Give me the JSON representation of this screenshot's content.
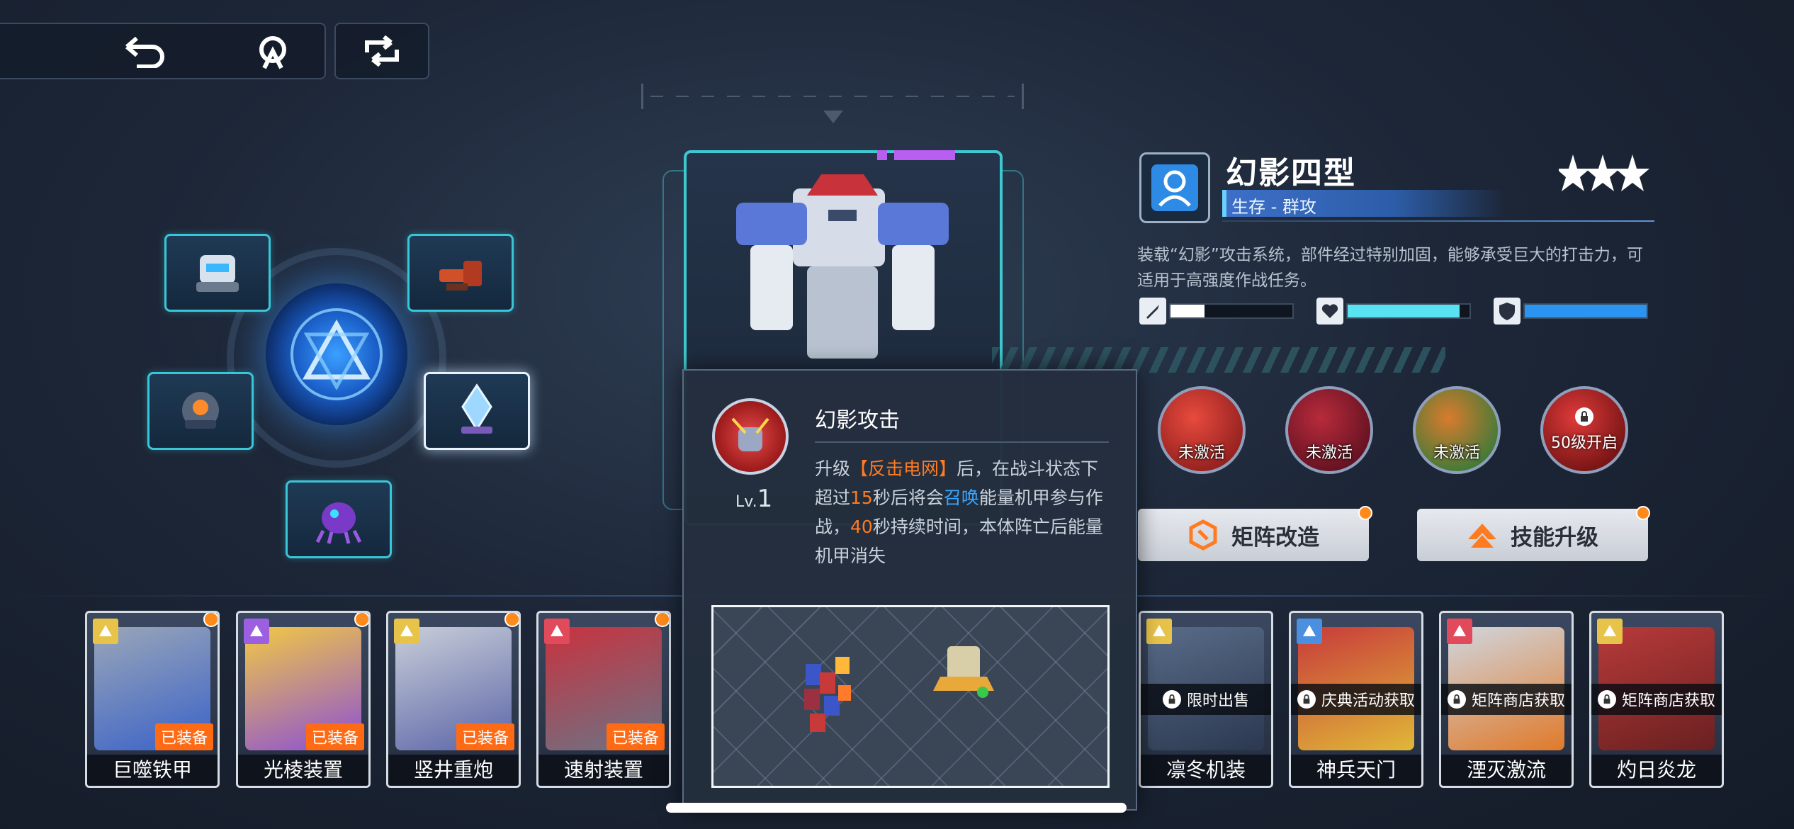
{
  "toolbar": {
    "back_icon": "undo-arrow-icon",
    "signal_icon": "wireless-tower-icon",
    "refresh_icon": "swap-arrows-icon"
  },
  "mech": {
    "name": "幻影四型",
    "tag": "生存 - 群攻",
    "rarity_stars": 3,
    "description": "装载“幻影”攻击系统，部件经过特别加固，能够承受巨大的打击力，可适用于高强度作战任务。",
    "stats": [
      {
        "icon": "sword-icon",
        "value": 0.28,
        "color": "#ffffff"
      },
      {
        "icon": "heart-icon",
        "value": 0.92,
        "color": "#58e2f2"
      },
      {
        "icon": "shield-icon",
        "value": 1.0,
        "color": "#2a94f0"
      }
    ]
  },
  "skills": [
    {
      "label": "未激活",
      "colors": [
        "#e84a3d",
        "#8a1c1c"
      ]
    },
    {
      "label": "未激活",
      "colors": [
        "#b82b3b",
        "#5a0f1f"
      ]
    },
    {
      "label": "未激活",
      "colors": [
        "#d97b2d",
        "#2f7a3a"
      ]
    },
    {
      "label": "50级开启",
      "colors": [
        "#e03a3a",
        "#6a1010"
      ]
    }
  ],
  "actions": {
    "matrix_label": "矩阵改造",
    "upgrade_label": "技能升级"
  },
  "popup": {
    "skill_name": "幻影攻击",
    "level_prefix": "Lv.",
    "level": "1",
    "desc_parts": [
      "升级",
      "【反击电网】",
      "后，在战斗状态下超过",
      "15",
      "秒后将会",
      "召唤",
      "能量机甲参与作战，",
      "40",
      "秒持续时间，本体阵亡后能量机甲消失"
    ]
  },
  "cards": [
    {
      "name": "巨噬铁甲",
      "badge": "已装备",
      "rank_color": "#e8c34a",
      "art": [
        "#9aa6b8",
        "#3a62c8"
      ]
    },
    {
      "name": "光棱装置",
      "badge": "已装备",
      "rank_color": "#9b5fe0",
      "art": [
        "#f2c944",
        "#8b4fd6"
      ]
    },
    {
      "name": "竖井重炮",
      "badge": "已装备",
      "rank_color": "#e8c34a",
      "art": [
        "#c9ced8",
        "#5b65a8"
      ]
    },
    {
      "name": "速射装置",
      "badge": "已装备",
      "rank_color": "#e04a5a",
      "art": [
        "#c9323e",
        "#6a7486"
      ]
    },
    {
      "name": "凛冬机装",
      "source": "限时出售",
      "rank_color": "#e8c34a",
      "art": [
        "#596c88",
        "#2b3850"
      ]
    },
    {
      "name": "神兵天门",
      "source": "庆典活动获取",
      "rank_color": "#4a8fe0",
      "art": [
        "#c83a3a",
        "#e0b838"
      ]
    },
    {
      "name": "湮灭激流",
      "source": "矩阵商店获取",
      "rank_color": "#e04a5a",
      "art": [
        "#d0d6de",
        "#e07a2a"
      ]
    },
    {
      "name": "灼日炎龙",
      "source": "矩阵商店获取",
      "rank_color": "#e8c34a",
      "art": [
        "#b83a3a",
        "#6a2020"
      ]
    }
  ]
}
